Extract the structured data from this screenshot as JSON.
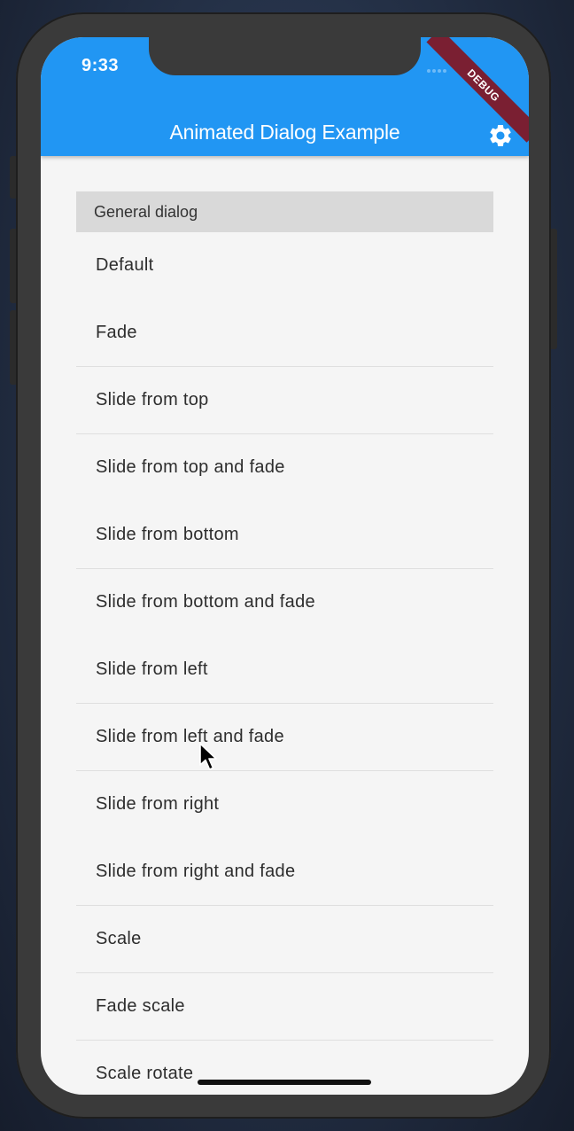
{
  "status_bar": {
    "time": "9:33"
  },
  "debug_banner": "DEBUG",
  "app_bar": {
    "title": "Animated Dialog Example",
    "settings_icon": "gear-icon",
    "color": "#2196f3"
  },
  "list": {
    "section_header": "General dialog",
    "items": [
      "Default",
      "Fade",
      "Slide from top",
      "Slide from top and fade",
      "Slide from bottom",
      "Slide from bottom and fade",
      "Slide from left",
      "Slide from left and fade",
      "Slide from right",
      "Slide from right and fade",
      "Scale",
      "Fade scale",
      "Scale rotate"
    ]
  }
}
